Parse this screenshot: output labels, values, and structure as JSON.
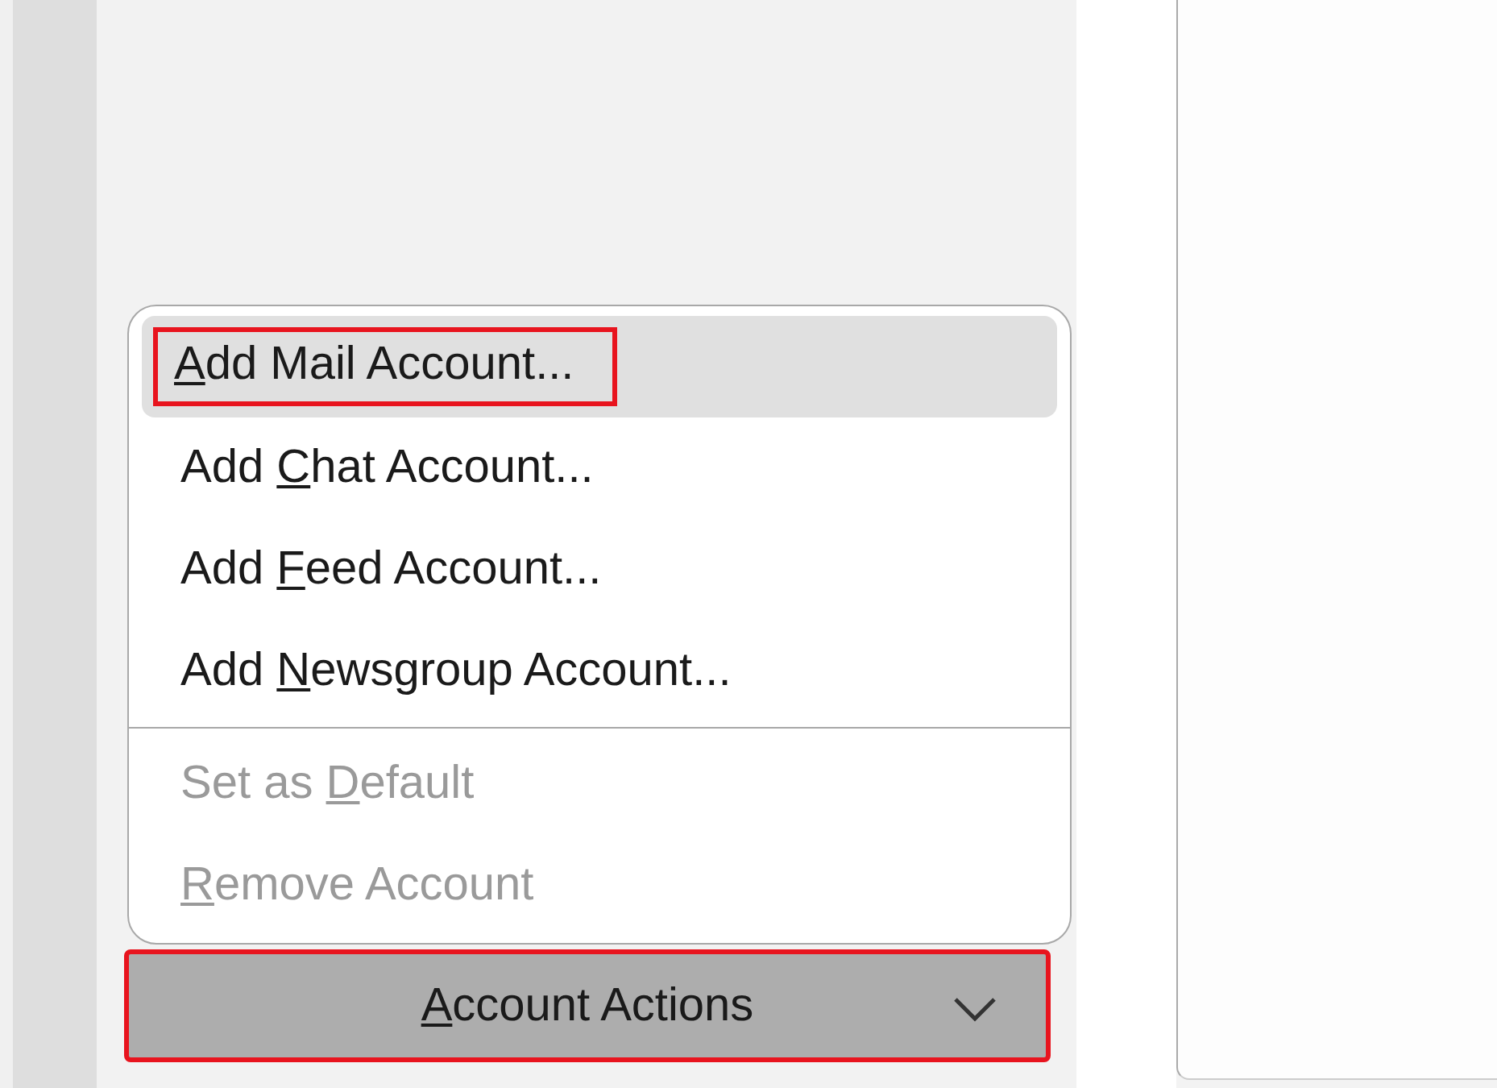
{
  "account_actions_menu": {
    "items": [
      {
        "kind": "item",
        "key": "A",
        "after": "dd Mail Account...",
        "hovered": true,
        "disabled": false,
        "annotated": true
      },
      {
        "kind": "item",
        "before": "Add ",
        "key": "C",
        "after": "hat Account...",
        "hovered": false,
        "disabled": false,
        "annotated": false
      },
      {
        "kind": "item",
        "before": "Add ",
        "key": "F",
        "after": "eed Account...",
        "hovered": false,
        "disabled": false,
        "annotated": false
      },
      {
        "kind": "item",
        "before": "Add ",
        "key": "N",
        "after": "ewsgroup Account...",
        "hovered": false,
        "disabled": false,
        "annotated": false
      },
      {
        "kind": "separator"
      },
      {
        "kind": "item",
        "before": "Set as ",
        "key": "D",
        "after": "efault",
        "hovered": false,
        "disabled": true,
        "annotated": false
      },
      {
        "kind": "item",
        "key": "R",
        "after": "emove Account",
        "hovered": false,
        "disabled": true,
        "annotated": false
      }
    ]
  },
  "account_actions_button": {
    "key": "A",
    "after": "ccount Actions",
    "annotated": true
  }
}
